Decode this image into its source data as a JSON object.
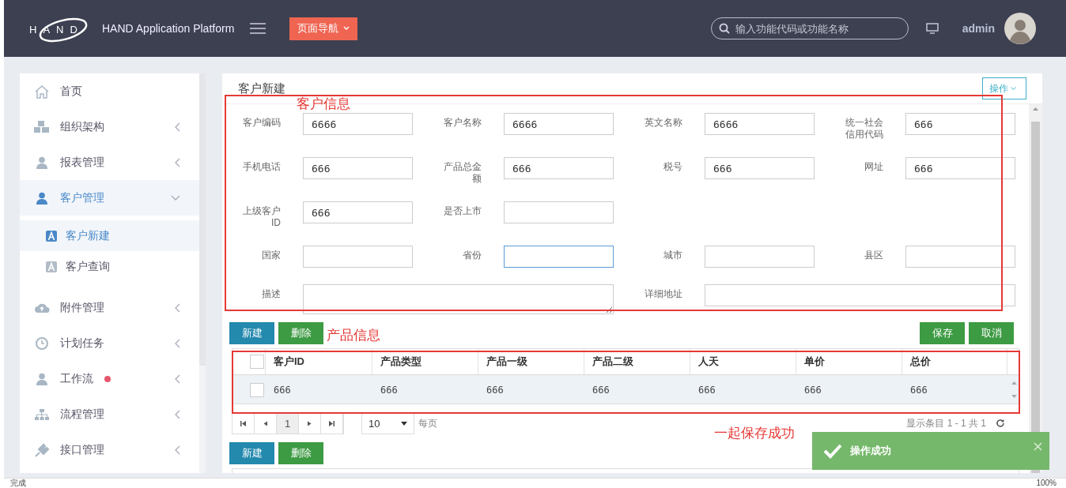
{
  "header": {
    "logo_text": "HAND",
    "title": "HAND Application Platform",
    "nav_button": "页面导航",
    "search": {
      "placeholder": "输入功能代码或功能名称"
    },
    "user": "admin"
  },
  "sidebar": {
    "items": [
      {
        "label": "首页",
        "kind": "link",
        "selected": false
      },
      {
        "label": "组织架构",
        "kind": "group",
        "expanded": false,
        "selected": false
      },
      {
        "label": "报表管理",
        "kind": "group",
        "expanded": false,
        "selected": false
      },
      {
        "label": "客户管理",
        "kind": "group",
        "expanded": true,
        "selected": true,
        "children": [
          {
            "label": "客户新建",
            "selected": true
          },
          {
            "label": "客户查询",
            "selected": false
          }
        ]
      },
      {
        "label": "附件管理",
        "kind": "group",
        "expanded": false,
        "selected": false
      },
      {
        "label": "计划任务",
        "kind": "group",
        "expanded": false,
        "selected": false
      },
      {
        "label": "工作流",
        "kind": "group",
        "expanded": false,
        "selected": false,
        "color": "#e8566b"
      },
      {
        "label": "流程管理",
        "kind": "group",
        "expanded": false,
        "selected": false
      },
      {
        "label": "接口管理",
        "kind": "group",
        "expanded": false,
        "selected": false
      }
    ]
  },
  "panel": {
    "title": "客户新建",
    "action_button": "操作",
    "form": {
      "rows": [
        [
          {
            "label": "客户编码",
            "value": "6666",
            "kind": "input",
            "focused": false
          },
          {
            "label": "客户名称",
            "value": "6666",
            "kind": "input",
            "focused": false
          },
          {
            "label": "英文名称",
            "value": "6666",
            "kind": "input",
            "focused": false
          },
          {
            "label": "统一社会信用代码",
            "value": "666",
            "kind": "input",
            "focused": false
          }
        ],
        [
          {
            "label": "手机电话",
            "value": "666",
            "kind": "input",
            "focused": false
          },
          {
            "label": "产品总金额",
            "value": "666",
            "kind": "input",
            "focused": false
          },
          {
            "label": "税号",
            "value": "666",
            "kind": "input",
            "focused": false
          },
          {
            "label": "网址",
            "value": "666",
            "kind": "input",
            "focused": false
          }
        ],
        [
          {
            "label": "上级客户ID",
            "value": "666",
            "kind": "input",
            "focused": false
          },
          {
            "label": "是否上市",
            "kind": "input",
            "focused": false
          }
        ],
        [
          {
            "label": "国家",
            "kind": "input",
            "focused": false
          },
          {
            "label": "省份",
            "kind": "input",
            "focused": true
          },
          {
            "label": "城市",
            "kind": "input",
            "focused": false
          },
          {
            "label": "县区",
            "kind": "input",
            "focused": false
          }
        ],
        [
          {
            "label": "描述",
            "kind": "textarea",
            "colspan": 2,
            "focused": false
          },
          {
            "label": "详细地址",
            "kind": "input",
            "colspan": 2,
            "focused": false
          }
        ]
      ]
    },
    "toolbar": {
      "left": [
        {
          "label": "新建",
          "kind": "primary"
        },
        {
          "label": "删除",
          "kind": "success"
        }
      ],
      "right": [
        {
          "label": "保存",
          "kind": "success"
        },
        {
          "label": "取消",
          "kind": "success"
        }
      ]
    },
    "table": {
      "columns": [
        "客户ID",
        "产品类型",
        "产品一级",
        "产品二级",
        "人天",
        "单价",
        "总价"
      ],
      "rows": [
        {
          "checked": false,
          "selected": true,
          "cells": [
            "666",
            "666",
            "666",
            "666",
            "666",
            "666",
            "666"
          ]
        }
      ],
      "header_checked": false
    },
    "pager": {
      "page": "1",
      "page_size": "10",
      "per_page": "每页",
      "summary": "显示条目 1 - 1 共 1"
    },
    "toolbar2": [
      {
        "label": "新建",
        "kind": "primary"
      },
      {
        "label": "删除",
        "kind": "success"
      }
    ],
    "annotations": {
      "customer_label": "客户信息",
      "product_label": "产品信息",
      "save_note": "一起保存成功"
    }
  },
  "toast": {
    "message": "操作成功"
  },
  "status_bar": {
    "left": "完成",
    "zoom": "100%"
  }
}
